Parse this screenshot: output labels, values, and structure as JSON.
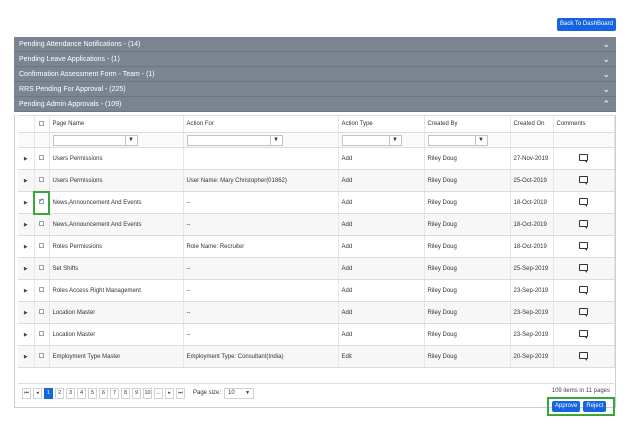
{
  "header": {
    "back_label": "Back To DashBoard"
  },
  "accordion": [
    {
      "title": "Pending Attendance Notifications - (14)",
      "chevron": "chevron-down-icon"
    },
    {
      "title": "Pending Leave Applications - (1)",
      "chevron": "chevron-down-icon"
    },
    {
      "title": "Confirmation Assessment Form - Team - (1)",
      "chevron": "chevron-down-icon"
    },
    {
      "title": "RRS Pending For Approval - (225)",
      "chevron": "chevron-down-icon"
    },
    {
      "title": "Pending Admin Approvals - (109)",
      "chevron": "chevron-up-icon"
    }
  ],
  "grid": {
    "columns": [
      "Page Name",
      "Action For",
      "Action Type",
      "Created By",
      "Created On",
      "Comments"
    ],
    "rows": [
      {
        "page": "Users Permissions",
        "action_for": "",
        "type": "Add",
        "by": "Riley Doug",
        "on": "27-Nov-2019",
        "checked": false
      },
      {
        "page": "Users Permissions",
        "action_for": "User Name: Mary Christopher(01862)",
        "type": "Add",
        "by": "Riley Doug",
        "on": "25-Oct-2019",
        "checked": false
      },
      {
        "page": "News,Announcement And Events",
        "action_for": "--",
        "type": "Add",
        "by": "Riley Doug",
        "on": "18-Oct-2019",
        "checked": true
      },
      {
        "page": "News,Announcement And Events",
        "action_for": "--",
        "type": "Add",
        "by": "Riley Doug",
        "on": "18-Oct-2019",
        "checked": false
      },
      {
        "page": "Roles Permissions",
        "action_for": "Role Name: Recruiter",
        "type": "Add",
        "by": "Riley Doug",
        "on": "18-Oct-2019",
        "checked": false
      },
      {
        "page": "Set Shifts",
        "action_for": "--",
        "type": "Add",
        "by": "Riley Doug",
        "on": "25-Sep-2019",
        "checked": false
      },
      {
        "page": "Roles Access Right Management",
        "action_for": "--",
        "type": "Add",
        "by": "Riley Doug",
        "on": "23-Sep-2019",
        "checked": false
      },
      {
        "page": "Location Master",
        "action_for": "--",
        "type": "Add",
        "by": "Riley Doug",
        "on": "23-Sep-2019",
        "checked": false
      },
      {
        "page": "Location Master",
        "action_for": "--",
        "type": "Add",
        "by": "Riley Doug",
        "on": "23-Sep-2019",
        "checked": false
      },
      {
        "page": "Employment Type Master",
        "action_for": "Employment Type: Consultant(India)",
        "type": "Edit",
        "by": "Riley Doug",
        "on": "20-Sep-2019",
        "checked": false
      }
    ]
  },
  "pager": {
    "first": "⏮",
    "prev": "◂",
    "pages": [
      "1",
      "2",
      "3",
      "4",
      "5",
      "6",
      "7",
      "8",
      "9",
      "10",
      "..."
    ],
    "next": "▸",
    "last": "⏭",
    "page_size_label": "Page size:",
    "page_size": "10",
    "info": "109 items in 11 pages"
  },
  "actions": {
    "approve": "Approve",
    "reject": "Reject"
  },
  "colors": {
    "accent": "#1565e0",
    "header_bg": "#7b8591",
    "highlight": "#3aa63a"
  }
}
